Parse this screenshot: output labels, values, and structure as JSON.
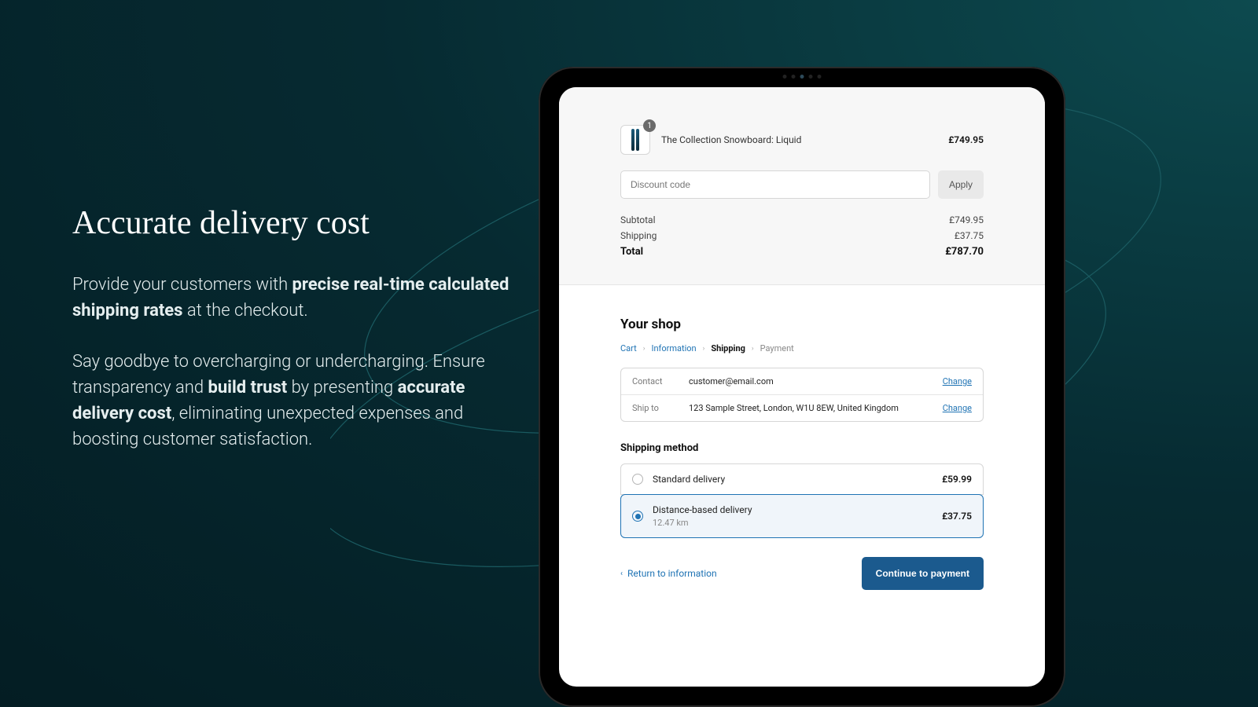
{
  "marketing": {
    "headline": "Accurate delivery cost",
    "para1_a": "Provide your customers with ",
    "para1_b": "precise real-time calculated shipping rates",
    "para1_c": " at the checkout.",
    "para2_a": "Say goodbye to overcharging or undercharging. Ensure transparency and ",
    "para2_b": "build trust",
    "para2_c": " by presenting ",
    "para2_d": "accurate delivery cost",
    "para2_e": ", eliminating unexpected expenses and boosting customer satisfaction."
  },
  "order": {
    "item_name": "The Collection Snowboard: Liquid",
    "item_price": "£749.95",
    "qty": "1",
    "discount_placeholder": "Discount code",
    "apply_label": "Apply",
    "subtotal_label": "Subtotal",
    "subtotal_value": "£749.95",
    "shipping_label": "Shipping",
    "shipping_value": "£37.75",
    "total_label": "Total",
    "total_value": "£787.70"
  },
  "checkout": {
    "shop_title": "Your shop",
    "breadcrumb": {
      "cart": "Cart",
      "info": "Information",
      "shipping": "Shipping",
      "payment": "Payment"
    },
    "contact_label": "Contact",
    "contact_value": "customer@email.com",
    "shipto_label": "Ship to",
    "shipto_value": "123 Sample Street, London, W1U 8EW, United Kingdom",
    "change_label": "Change",
    "shipping_method_label": "Shipping method",
    "opt1_name": "Standard delivery",
    "opt1_price": "£59.99",
    "opt2_name": "Distance-based delivery",
    "opt2_sub": "12.47 km",
    "opt2_price": "£37.75",
    "return_label": "Return to information",
    "continue_label": "Continue to payment"
  }
}
